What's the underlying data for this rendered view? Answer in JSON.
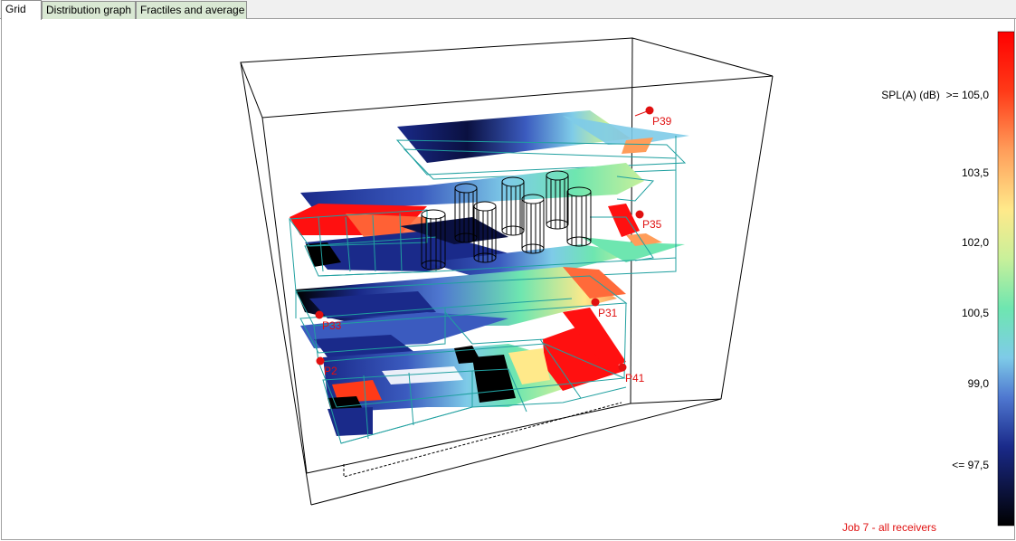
{
  "tabs": [
    {
      "label": "Grid",
      "active": true
    },
    {
      "label": "Distribution graph",
      "active": false
    },
    {
      "label": "Fractiles and average",
      "active": false
    }
  ],
  "legend": {
    "title": "SPL(A) (dB)",
    "labels": [
      ">= 105,0",
      "103,5",
      "102,0",
      "100,5",
      "99,0",
      "<= 97,5"
    ],
    "gradient_colors": [
      "#ff0000",
      "#ff4a1a",
      "#ff9d5a",
      "#ffe98a",
      "#c8f09a",
      "#6ee6b0",
      "#7ecbe8",
      "#4f78d0",
      "#1a2a8a",
      "#000000"
    ]
  },
  "receivers": [
    "P39",
    "P35",
    "P31",
    "P33",
    "P2",
    "P41"
  ],
  "status": "Job 7 - all receivers",
  "colors": {
    "receiver": "#e01010",
    "mesh": "#20a0a0",
    "box": "#000000"
  }
}
